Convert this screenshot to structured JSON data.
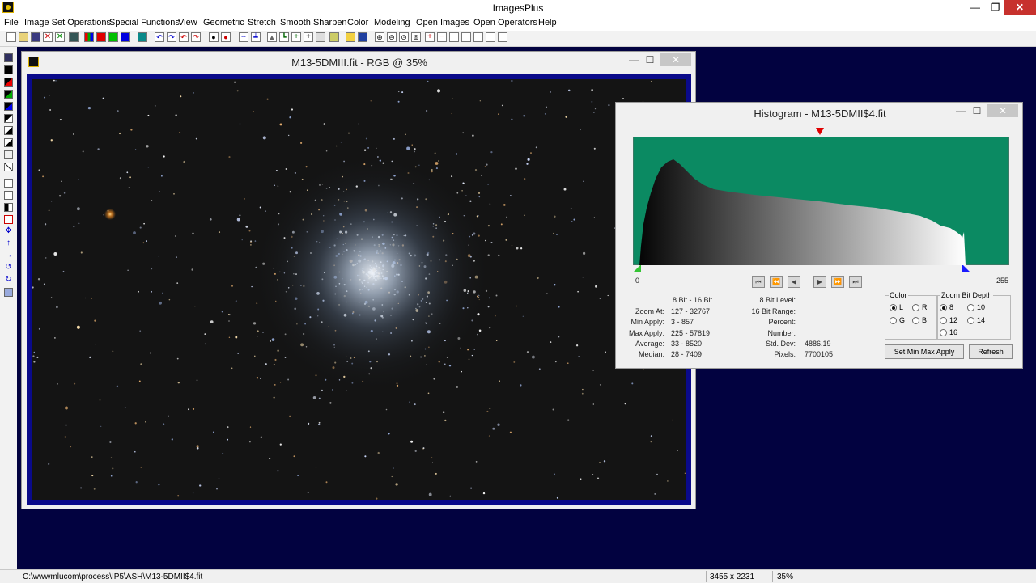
{
  "app": {
    "title": "ImagesPlus"
  },
  "window_controls": {
    "minimize": "—",
    "maximize": "❐",
    "close": "✕"
  },
  "menu": [
    "File",
    "Image Set Operations",
    "Special Functions",
    "View",
    "Geometric",
    "Stretch",
    "Smooth Sharpen",
    "Color",
    "Modeling",
    "Open Images",
    "Open Operators",
    "Help"
  ],
  "image_window": {
    "title": "M13-5DMIII.fit - RGB @ 35%",
    "minimize": "—",
    "maximize": "☐",
    "close": "✕"
  },
  "histogram_window": {
    "title": "Histogram - M13-5DMII$4.fit",
    "minimize": "—",
    "maximize": "☐",
    "close": "✕",
    "axis_min": "0",
    "axis_max": "255",
    "stats_header": "8 Bit - 16 Bit",
    "stats": [
      {
        "label": "Zoom At:",
        "value": "127 - 32767"
      },
      {
        "label": "Min Apply:",
        "value": "3 - 857"
      },
      {
        "label": "Max Apply:",
        "value": "225 - 57819"
      },
      {
        "label": "Average:",
        "value": "33 - 8520"
      },
      {
        "label": "Median:",
        "value": "28 - 7409"
      }
    ],
    "level": [
      {
        "label": "8 Bit Level:",
        "value": ""
      },
      {
        "label": "16 Bit Range:",
        "value": ""
      },
      {
        "label": "Percent:",
        "value": ""
      },
      {
        "label": "Number:",
        "value": ""
      },
      {
        "label": "Std. Dev:",
        "value": "4886.19"
      },
      {
        "label": "Pixels:",
        "value": "7700105"
      }
    ],
    "color_group": {
      "legend": "Color",
      "options": [
        "L",
        "R",
        "G",
        "B"
      ],
      "selected": "L"
    },
    "zoom_group": {
      "legend": "Zoom Bit Depth",
      "options": [
        "8",
        "10",
        "12",
        "14",
        "16"
      ],
      "selected": "8"
    },
    "set_min_max_label": "Set Min Max Apply",
    "refresh_label": "Refresh",
    "marker_positions": {
      "min_apply": 3,
      "max_apply": 225,
      "zoom_at": 127
    },
    "colors": {
      "background": "#0b8a62",
      "min_marker": "#35c435",
      "max_marker": "#1a1aff",
      "zoom_marker": "#e00000"
    }
  },
  "status": {
    "path": "C:\\wwwmlucom\\process\\IP5\\ASH\\M13-5DMII$4.fit",
    "dimensions": "3455 x 2231",
    "zoom": "35%"
  },
  "colors": {
    "desktop": "#020240",
    "image_border": "#0a0a8a",
    "close_button": "#c7312d"
  }
}
